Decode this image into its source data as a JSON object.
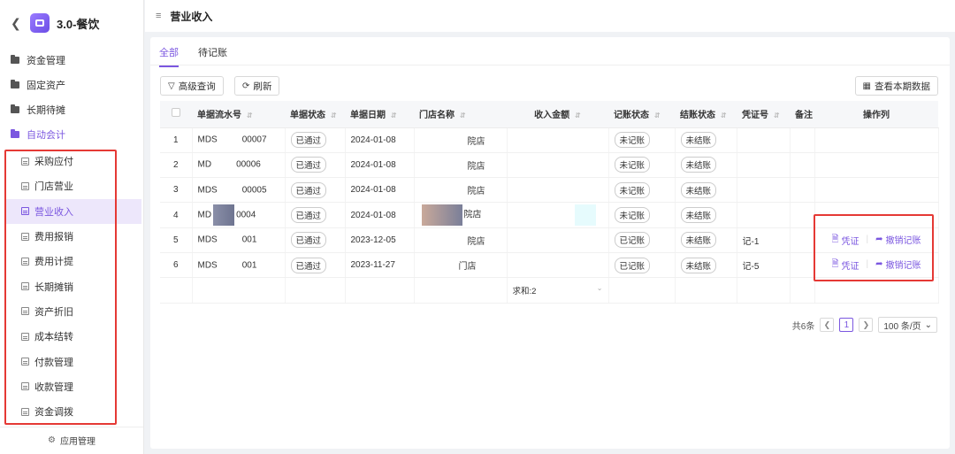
{
  "app": {
    "title": "3.0-餐饮",
    "footer_label": "应用管理"
  },
  "sidebar": {
    "groups": [
      {
        "label": "资金管理"
      },
      {
        "label": "固定资产"
      },
      {
        "label": "长期待摊"
      },
      {
        "label": "自动会计"
      }
    ],
    "items": [
      {
        "label": "采购应付"
      },
      {
        "label": "门店营业"
      },
      {
        "label": "营业收入",
        "active": true
      },
      {
        "label": "费用报销"
      },
      {
        "label": "费用计提"
      },
      {
        "label": "长期摊销"
      },
      {
        "label": "资产折旧"
      },
      {
        "label": "成本结转"
      },
      {
        "label": "付款管理"
      },
      {
        "label": "收款管理"
      },
      {
        "label": "资金调拨"
      }
    ]
  },
  "header": {
    "title": "营业收入"
  },
  "tabs": [
    {
      "label": "全部",
      "active": true
    },
    {
      "label": "待记账"
    }
  ],
  "toolbar": {
    "filter_label": "高级查询",
    "refresh_label": "刷新",
    "view_period_label": "查看本期数据"
  },
  "table": {
    "columns": [
      "单据流水号",
      "单据状态",
      "单据日期",
      "门店名称",
      "收入金额",
      "记账状态",
      "结账状态",
      "凭证号",
      "备注",
      "操作列"
    ],
    "rows": [
      {
        "index": "1",
        "serial_a": "MDS",
        "serial_b": "00007",
        "status": "已通过",
        "date": "2024-01-08",
        "store": "院店",
        "booking": "未记账",
        "closing": "未结账",
        "voucher": ""
      },
      {
        "index": "2",
        "serial_a": "MD",
        "serial_b": "00006",
        "status": "已通过",
        "date": "2024-01-08",
        "store": "院店",
        "booking": "未记账",
        "closing": "未结账",
        "voucher": ""
      },
      {
        "index": "3",
        "serial_a": "MDS",
        "serial_b": "00005",
        "status": "已通过",
        "date": "2024-01-08",
        "store": "院店",
        "booking": "未记账",
        "closing": "未结账",
        "voucher": ""
      },
      {
        "index": "4",
        "serial_a": "MD",
        "serial_b": "0004",
        "status": "已通过",
        "date": "2024-01-08",
        "store": "院店",
        "booking": "未记账",
        "closing": "未结账",
        "voucher": ""
      },
      {
        "index": "5",
        "serial_a": "MDS",
        "serial_b": "001",
        "status": "已通过",
        "date": "2023-12-05",
        "store": "院店",
        "booking": "已记账",
        "closing": "未结账",
        "voucher": "记-1"
      },
      {
        "index": "6",
        "serial_a": "MDS",
        "serial_b": "001",
        "status": "已通过",
        "date": "2023-11-27",
        "store": "门店",
        "booking": "已记账",
        "closing": "未结账",
        "voucher": "记-5"
      }
    ],
    "sum_label": "求和:2",
    "op_voucher_label": "凭证",
    "op_undo_label": "撤销记账"
  },
  "pagination": {
    "total_label": "共6条",
    "current_page": "1",
    "page_size_label": "100 条/页"
  },
  "colors": {
    "accent": "#7b57e0",
    "highlight_box": "#e53935"
  }
}
